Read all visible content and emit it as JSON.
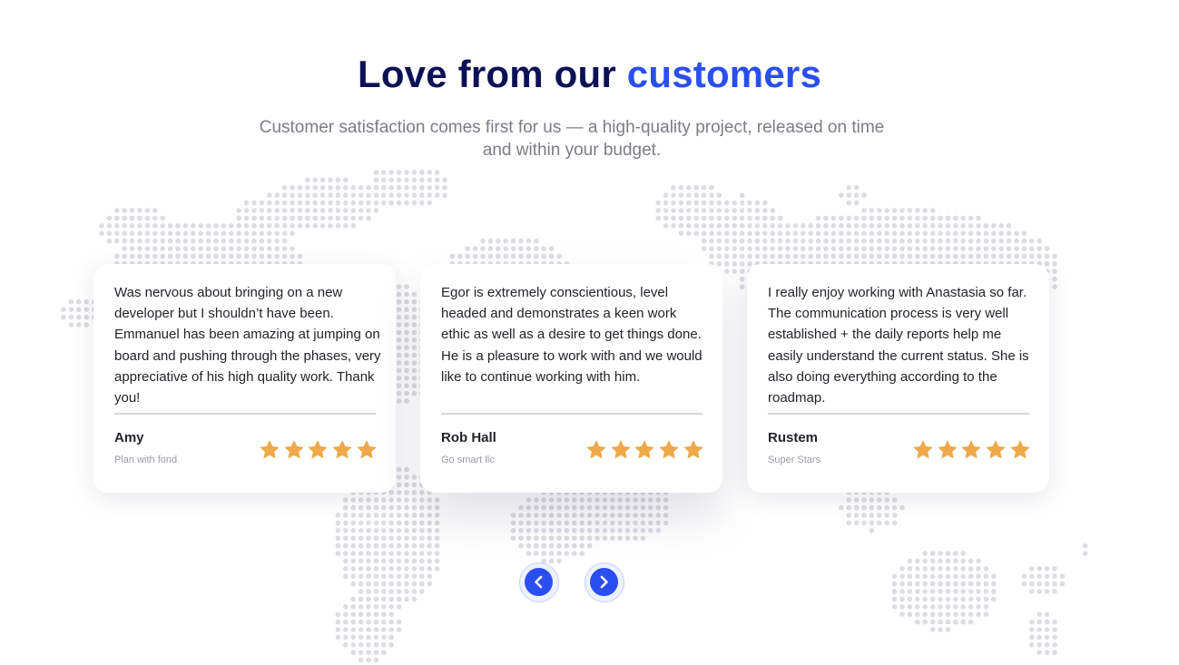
{
  "section": {
    "title_main": "Love from our",
    "title_accent": "customers",
    "subtitle": "Customer satisfaction comes first for us — a high-quality project, released on time and within your budget."
  },
  "colors": {
    "heading": "#0b1154",
    "accent": "#2a4ef2",
    "star": "#f0a948",
    "map_dot": "#dcdce2"
  },
  "testimonials": [
    {
      "quote": "Was nervous about bringing on a new developer but I shouldn’t have been. Emmanuel has been amazing at jumping on board and pushing through the phases, very appreciative of his high quality work. Thank you!",
      "name": "Amy",
      "company": "Plan with fond",
      "rating": 5
    },
    {
      "quote": "Egor is extremely conscientious, level headed and demonstrates a keen work ethic as well as a desire to get things done. He is a pleasure to work with and we would like to continue working with him.",
      "name": "Rob Hall",
      "company": "Go smart llc",
      "rating": 5
    },
    {
      "quote": "I really enjoy working with Anastasia so far. The communication process is very well established + the daily reports help me easily understand the current status. She is also doing everything according to the roadmap.",
      "name": "Rustem",
      "company": "Super Stars",
      "rating": 5
    }
  ],
  "nav": {
    "prev_icon": "chevron-left-icon",
    "next_icon": "chevron-right-icon"
  }
}
